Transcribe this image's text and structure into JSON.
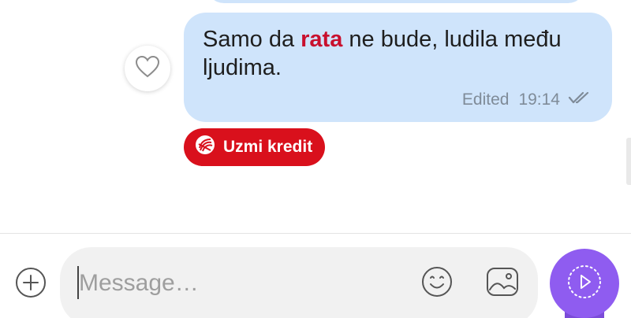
{
  "message": {
    "text_before": "Samo da ",
    "text_highlight": "rata",
    "text_after": " ne bude, ludila među ljudima.",
    "edited_label": "Edited",
    "time": "19:14",
    "status_icon": "double-check-icon",
    "colors": {
      "bubble": "#cfe4fb",
      "highlight": "#c8102e"
    }
  },
  "reaction": {
    "icon": "heart-icon"
  },
  "promo": {
    "label": "Uzmi kredit",
    "icon": "bank-logo-icon",
    "color": "#d9101c"
  },
  "composer": {
    "placeholder": "Message…",
    "add_icon": "plus-circle-icon",
    "emoji_icon": "smiley-icon",
    "gallery_icon": "image-icon",
    "send_icon": "play-icon",
    "send_color": "#8f5cf0"
  }
}
